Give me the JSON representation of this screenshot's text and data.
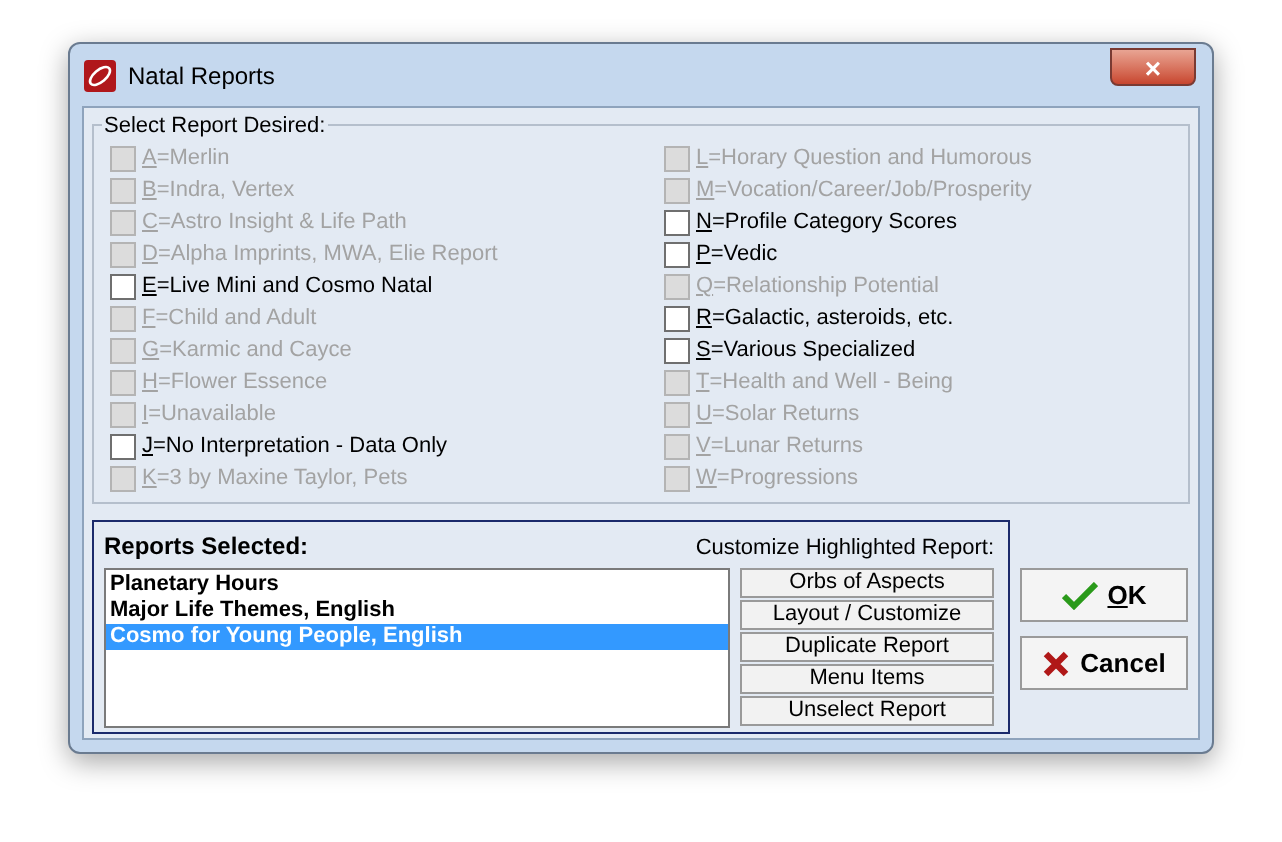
{
  "window": {
    "title": "Natal Reports",
    "close": "×"
  },
  "report_group": {
    "title": "Select Report Desired:",
    "columns": [
      [
        {
          "label": "A=Merlin",
          "disabled": true,
          "checked": false
        },
        {
          "label": "B=Indra, Vertex",
          "disabled": true,
          "checked": false
        },
        {
          "label": "C=Astro Insight & Life Path",
          "disabled": true,
          "checked": false
        },
        {
          "label": "D=Alpha Imprints, MWA, Elie Report",
          "disabled": true,
          "checked": false
        },
        {
          "label": "E=Live Mini and Cosmo Natal",
          "disabled": false,
          "checked": false
        },
        {
          "label": "F=Child and Adult",
          "disabled": true,
          "checked": false
        },
        {
          "label": "G=Karmic and Cayce",
          "disabled": true,
          "checked": false
        },
        {
          "label": "H=Flower Essence",
          "disabled": true,
          "checked": false
        },
        {
          "label": "I=Unavailable",
          "disabled": true,
          "checked": false
        },
        {
          "label": "J=No Interpretation - Data Only",
          "disabled": false,
          "checked": false
        },
        {
          "label": "K=3 by Maxine Taylor, Pets",
          "disabled": true,
          "checked": false
        }
      ],
      [
        {
          "label": "L=Horary Question and Humorous",
          "disabled": true,
          "checked": false
        },
        {
          "label": "M=Vocation/Career/Job/Prosperity",
          "disabled": true,
          "checked": false
        },
        {
          "label": "N=Profile Category Scores",
          "disabled": false,
          "checked": false
        },
        {
          "label": "P=Vedic",
          "disabled": false,
          "checked": false
        },
        {
          "label": "Q=Relationship Potential",
          "disabled": true,
          "checked": false
        },
        {
          "label": "R=Galactic, asteroids, etc.",
          "disabled": false,
          "checked": false
        },
        {
          "label": "S=Various Specialized",
          "disabled": false,
          "checked": false
        },
        {
          "label": "T=Health and Well - Being",
          "disabled": true,
          "checked": false
        },
        {
          "label": "U=Solar Returns",
          "disabled": true,
          "checked": false
        },
        {
          "label": "V=Lunar Returns",
          "disabled": true,
          "checked": false
        },
        {
          "label": "W=Progressions",
          "disabled": true,
          "checked": false
        }
      ]
    ]
  },
  "selected_panel": {
    "title": "Reports Selected:",
    "customize_label": "Customize Highlighted Report:",
    "reports": [
      {
        "label": "Planetary Hours",
        "selected": false
      },
      {
        "label": "Major Life Themes, English",
        "selected": false
      },
      {
        "label": "Cosmo for Young People, English",
        "selected": true
      }
    ],
    "buttons": [
      "Orbs of Aspects",
      "Layout / Customize",
      "Duplicate Report",
      "Menu Items",
      "Unselect Report"
    ]
  },
  "dialog_buttons": [
    {
      "kind": "ok",
      "label": "OK"
    },
    {
      "kind": "cancel",
      "label": "Cancel"
    }
  ]
}
